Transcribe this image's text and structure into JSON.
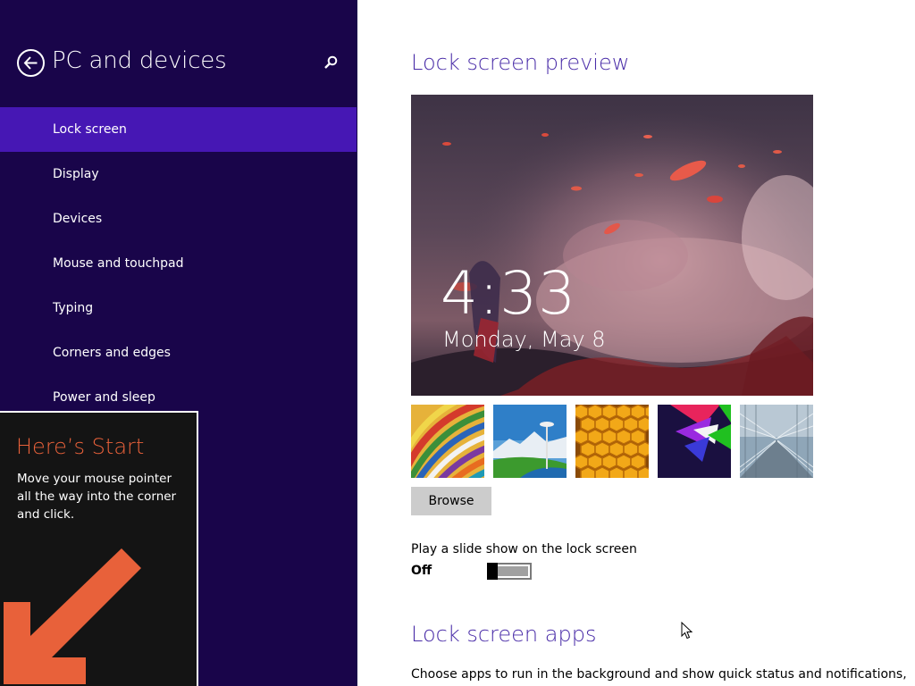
{
  "nav": {
    "title": "PC and devices",
    "back_icon": "back-arrow-icon",
    "search_icon": "search-icon",
    "items": [
      {
        "label": "Lock screen",
        "selected": true
      },
      {
        "label": "Display",
        "selected": false
      },
      {
        "label": "Devices",
        "selected": false
      },
      {
        "label": "Mouse and touchpad",
        "selected": false
      },
      {
        "label": "Typing",
        "selected": false
      },
      {
        "label": "Corners and edges",
        "selected": false
      },
      {
        "label": "Power and sleep",
        "selected": false
      }
    ]
  },
  "tip": {
    "title": "Here’s Start",
    "body": "Move your mouse pointer all the way into the corner and click.",
    "arrow_icon": "arrow-down-left-icon"
  },
  "main": {
    "preview_heading": "Lock screen preview",
    "preview": {
      "time": "4:33",
      "date": "Monday, May 8"
    },
    "thumbnails": [
      "colorful-stripes",
      "space-needle-landscape",
      "honeycomb",
      "geometric-shapes",
      "rail-tunnel"
    ],
    "browse_label": "Browse",
    "slideshow": {
      "label": "Play a slide show on the lock screen",
      "state": "Off",
      "on": false
    },
    "apps_heading": "Lock screen apps",
    "apps_description": "Choose apps to run in the background and show quick status and notifications,"
  },
  "colors": {
    "nav_bg": "#19054a",
    "nav_selected": "#4617b4",
    "heading_accent": "#4a2da8",
    "tip_accent": "#e8613a"
  }
}
